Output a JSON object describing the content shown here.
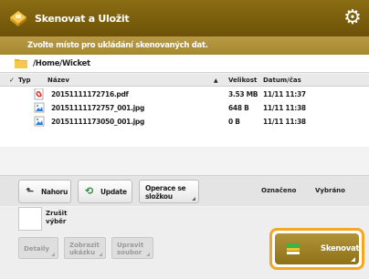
{
  "header": {
    "title": "Skenovat a Uložit",
    "icon": "app-scan-save-icon",
    "settings_icon": "gear-icon"
  },
  "subheader": {
    "text": "Zvolte místo pro ukládání skenovaných dat."
  },
  "path": {
    "text": "/Home/Wicket"
  },
  "table": {
    "headers": {
      "check": "✓",
      "type": "Typ",
      "name": "Název",
      "sort": "▲",
      "size": "Velikost",
      "date": "Datum/čas"
    },
    "rows": [
      {
        "icon": "pdf-file-icon",
        "name": "20151111172716.pdf",
        "size": "3.53 MB",
        "date": "11/11 11:37"
      },
      {
        "icon": "jpg-file-icon",
        "name": "20151111172757_001.jpg",
        "size": "648 B",
        "date": "11/11 11:38"
      },
      {
        "icon": "jpg-file-icon",
        "name": "20151111173050_001.jpg",
        "size": "0 B",
        "date": "11/11 11:38"
      }
    ]
  },
  "toolbar": {
    "up": "Nahoru",
    "refresh": "Update",
    "operations": "Operace se složkou",
    "selected": "Označeno",
    "selected_label": "Vybráno",
    "operations_line1": "Operace se",
    "operations_line2": "složkou"
  },
  "lower": {
    "check_label_line1": "Zrušit",
    "check_label_line2": "výběr",
    "details": "Detaily",
    "show_all_line1": "Zobrazit",
    "show_all_line2": "ukázku",
    "edit_file_line1": "Upravit",
    "edit_file_line2": "soubor",
    "save": "Skenovat"
  },
  "colors": {
    "title_bar": "#7c600e",
    "subheader": "#ad8f38",
    "highlight": "#f5a623"
  }
}
